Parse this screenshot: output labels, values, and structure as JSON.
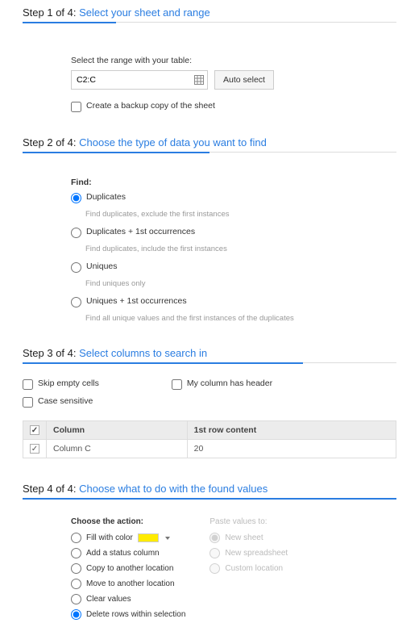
{
  "step1": {
    "prefix": "Step 1 of 4: ",
    "title": "Select your sheet and range",
    "range_label": "Select the range with your table:",
    "range_value": "C2:C",
    "auto_select": "Auto select",
    "backup_label": "Create a backup copy of the sheet"
  },
  "step2": {
    "prefix": "Step 2 of 4: ",
    "title": "Choose the type of data you want to find",
    "find_label": "Find:",
    "options": [
      {
        "label": "Duplicates",
        "desc": "Find duplicates, exclude the first instances"
      },
      {
        "label": "Duplicates + 1st occurrences",
        "desc": "Find duplicates, include the first instances"
      },
      {
        "label": "Uniques",
        "desc": "Find uniques only"
      },
      {
        "label": "Uniques + 1st occurrences",
        "desc": "Find all unique values and the first instances of the duplicates"
      }
    ]
  },
  "step3": {
    "prefix": "Step 3 of 4: ",
    "title": "Select columns to search in",
    "skip_empty": "Skip empty cells",
    "has_header": "My column has header",
    "case_sensitive": "Case sensitive",
    "col_header": "Column",
    "content_header": "1st row content",
    "row_col": "Column C",
    "row_content": "20"
  },
  "step4": {
    "prefix": "Step 4 of 4: ",
    "title": "Choose what to do with the found values",
    "choose_action": "Choose the action:",
    "paste_to": "Paste values to:",
    "fill_color": "Fill with color",
    "add_status": "Add a status column",
    "copy_loc": "Copy to another location",
    "move_loc": "Move to another location",
    "clear": "Clear values",
    "delete_rows": "Delete rows within selection",
    "new_sheet": "New sheet",
    "new_spreadsheet": "New spreadsheet",
    "custom_loc": "Custom location"
  }
}
